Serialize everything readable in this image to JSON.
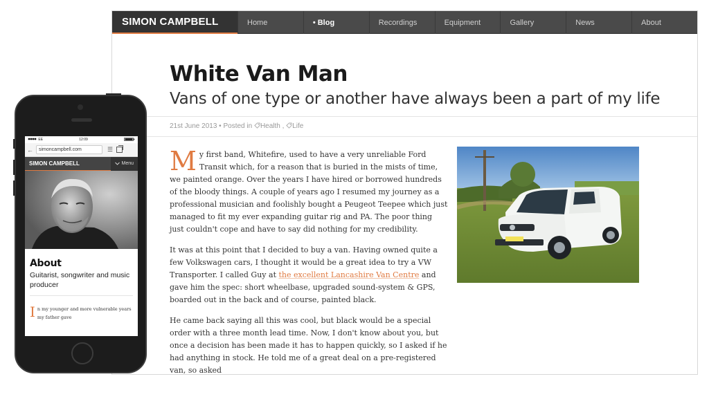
{
  "site": {
    "brand": "SIMON CAMPBELL",
    "nav": [
      "Home",
      "Blog",
      "Recordings",
      "Equipment",
      "Gallery",
      "News",
      "About"
    ],
    "active_nav": "Blog",
    "accent_color": "#e07b42"
  },
  "post": {
    "title": "White Van Man",
    "subtitle": "Vans of one type or another have always been a part of my life",
    "date": "21st June 2013",
    "posted_in": "Posted in",
    "separator": "•",
    "tags": [
      "Health",
      "Life"
    ],
    "tag_separator": ",",
    "tag_icon": "tag-icon",
    "dropcap": "M",
    "paragraph1_rest": "y first band, Whitefire, used to have a very unreliable Ford Transit which, for a reason that is buried in the mists of time, we painted orange. Over the years I have hired or borrowed hundreds of the bloody things. A couple of years ago I resumed my journey as a professional musician and foolishly bought a Peugeot Teepee which just managed to fit my ever expanding guitar rig and PA. The poor thing just couldn't cope and have to say did nothing for my credibility.",
    "paragraph2_before_link": "It was at this point that I decided to buy a van. Having owned quite a few Volkswagen cars, I thought it would be a great idea to try a VW Transporter. I called Guy at ",
    "paragraph2_link": "the excellent Lancashire Van Centre",
    "paragraph2_after_link": " and gave him the spec: short wheelbase, upgraded sound-system & GPS, boarded out in the back and of course, painted black.",
    "paragraph3": "He came back saying all this was cool, but black would be a special order with a three month lead time. Now, I don't know about you, but once a decision has been made it has to happen quickly, so I asked if he had anything in stock. He told me of a great deal on a pre-registered van, so asked"
  },
  "phone": {
    "carrier": "EE",
    "time": "12:09",
    "url": "simoncampbell.com",
    "brand": "SIMON CAMPBELL",
    "menu_label": "Menu",
    "menu_icon": "chevron-down-icon",
    "about_title": "About",
    "about_sub": "Guitarist, songwriter and music producer",
    "dropcap": "I",
    "body_rest": "n my younger and more vulnerable years my father gave"
  }
}
